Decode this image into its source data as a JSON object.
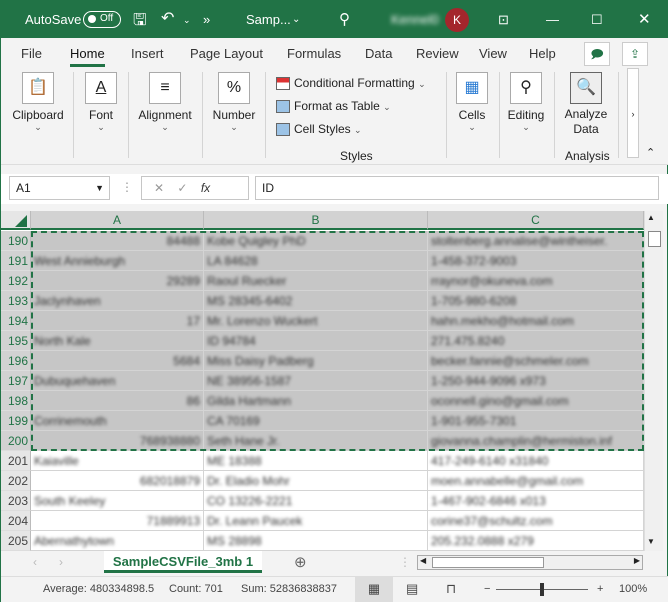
{
  "titlebar": {
    "autosave_label": "AutoSave",
    "autosave_state": "Off",
    "filename": "Samp...",
    "avatar_initial": "K",
    "account_name": "Kennel0"
  },
  "tabs": [
    "File",
    "Home",
    "Insert",
    "Page Layout",
    "Formulas",
    "Data",
    "Review",
    "View",
    "Help"
  ],
  "active_tab": "Home",
  "ribbon": {
    "clipboard": "Clipboard",
    "font": "Font",
    "alignment": "Alignment",
    "number": "Number",
    "number_icon": "%",
    "conditional_formatting": "Conditional Formatting",
    "format_as_table": "Format as Table",
    "cell_styles": "Cell Styles",
    "styles_group": "Styles",
    "cells": "Cells",
    "editing": "Editing",
    "analyze_data": "Analyze Data",
    "analysis_group": "Analysis"
  },
  "formula_bar": {
    "name_box": "A1",
    "fx": "fx",
    "value": "ID"
  },
  "columns": [
    "A",
    "B",
    "C"
  ],
  "rows": [
    {
      "n": "190",
      "a": "84488",
      "b": "Kobe Quigley PhD",
      "c": "stoltenberg.annalise@wintheiser.",
      "sel": true,
      "a_right": true
    },
    {
      "n": "191",
      "a": "West Annieburgh",
      "b": "LA 84628",
      "c": "1-458-372-9003",
      "sel": true
    },
    {
      "n": "192",
      "a": "29289",
      "b": "Raoul Ruecker",
      "c": "rraynor@okuneva.com",
      "sel": true,
      "a_right": true
    },
    {
      "n": "193",
      "a": "Jaclynhaven",
      "b": "MS 28345-6402",
      "c": "1-705-980-6208",
      "sel": true
    },
    {
      "n": "194",
      "a": "17",
      "b": "Mr. Lorenzo Wuckert",
      "c": "hahn.mekho@hotmail.com",
      "sel": true,
      "a_right": true
    },
    {
      "n": "195",
      "a": "North Kale",
      "b": "ID 94784",
      "c": "271.475.8240",
      "sel": true
    },
    {
      "n": "196",
      "a": "5684",
      "b": "Miss Daisy Padberg",
      "c": "becker.fannie@schmeler.com",
      "sel": true,
      "a_right": true
    },
    {
      "n": "197",
      "a": "Dubuquehaven",
      "b": "NE 38956-1587",
      "c": "1-250-944-9096 x973",
      "sel": true
    },
    {
      "n": "198",
      "a": "86",
      "b": "Gilda Hartmann",
      "c": "oconnell.gino@gmail.com",
      "sel": true,
      "a_right": true
    },
    {
      "n": "199",
      "a": "Corrinemouth",
      "b": "CA 70169",
      "c": "1-901-955-7301",
      "sel": true
    },
    {
      "n": "200",
      "a": "768938880",
      "b": "Seth Hane Jr.",
      "c": "giovanna.champlin@hermiston.inf",
      "sel": true,
      "a_right": true
    },
    {
      "n": "201",
      "a": "Kaiaville",
      "b": "ME 18388",
      "c": "417-249-6140 x31840"
    },
    {
      "n": "202",
      "a": "682018879",
      "b": "Dr. Eladio Mohr",
      "c": "moen.annabelle@gmail.com",
      "a_right": true
    },
    {
      "n": "203",
      "a": "South Keeley",
      "b": "CO 13226-2221",
      "c": "1-467-902-6846 x013"
    },
    {
      "n": "204",
      "a": "71889913",
      "b": "Dr. Leann Paucek",
      "c": "corine37@schultz.com",
      "a_right": true
    },
    {
      "n": "205",
      "a": "Abernathytown",
      "b": "MS 28898",
      "c": "205.232.0888 x279"
    }
  ],
  "sheet_tab": "SampleCSVFile_3mb 1",
  "status": {
    "average": "Average: 480334898.5",
    "count": "Count: 701",
    "sum": "Sum: 52836838837",
    "zoom": "100%",
    "zoom_level": 100
  },
  "colors": {
    "brand": "#217346",
    "avatar": "#a4262c"
  }
}
